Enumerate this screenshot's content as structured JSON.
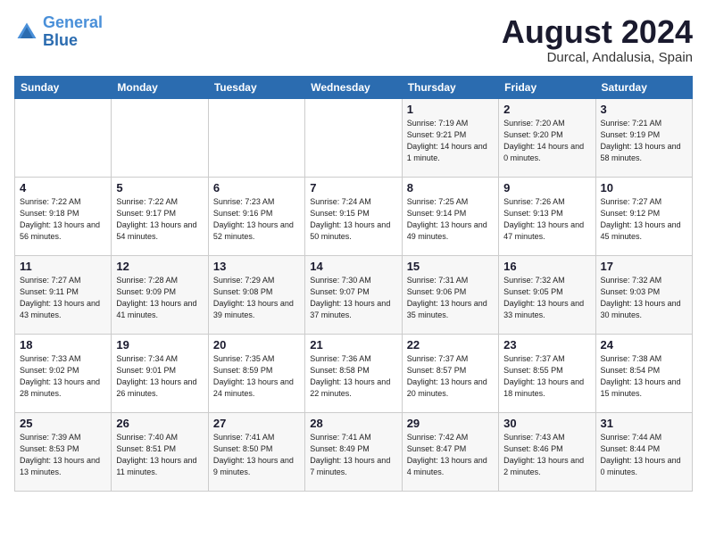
{
  "header": {
    "logo_line1": "General",
    "logo_line2": "Blue",
    "month_year": "August 2024",
    "location": "Durcal, Andalusia, Spain"
  },
  "weekdays": [
    "Sunday",
    "Monday",
    "Tuesday",
    "Wednesday",
    "Thursday",
    "Friday",
    "Saturday"
  ],
  "weeks": [
    [
      {
        "day": "",
        "info": ""
      },
      {
        "day": "",
        "info": ""
      },
      {
        "day": "",
        "info": ""
      },
      {
        "day": "",
        "info": ""
      },
      {
        "day": "1",
        "info": "Sunrise: 7:19 AM\nSunset: 9:21 PM\nDaylight: 14 hours\nand 1 minute."
      },
      {
        "day": "2",
        "info": "Sunrise: 7:20 AM\nSunset: 9:20 PM\nDaylight: 14 hours\nand 0 minutes."
      },
      {
        "day": "3",
        "info": "Sunrise: 7:21 AM\nSunset: 9:19 PM\nDaylight: 13 hours\nand 58 minutes."
      }
    ],
    [
      {
        "day": "4",
        "info": "Sunrise: 7:22 AM\nSunset: 9:18 PM\nDaylight: 13 hours\nand 56 minutes."
      },
      {
        "day": "5",
        "info": "Sunrise: 7:22 AM\nSunset: 9:17 PM\nDaylight: 13 hours\nand 54 minutes."
      },
      {
        "day": "6",
        "info": "Sunrise: 7:23 AM\nSunset: 9:16 PM\nDaylight: 13 hours\nand 52 minutes."
      },
      {
        "day": "7",
        "info": "Sunrise: 7:24 AM\nSunset: 9:15 PM\nDaylight: 13 hours\nand 50 minutes."
      },
      {
        "day": "8",
        "info": "Sunrise: 7:25 AM\nSunset: 9:14 PM\nDaylight: 13 hours\nand 49 minutes."
      },
      {
        "day": "9",
        "info": "Sunrise: 7:26 AM\nSunset: 9:13 PM\nDaylight: 13 hours\nand 47 minutes."
      },
      {
        "day": "10",
        "info": "Sunrise: 7:27 AM\nSunset: 9:12 PM\nDaylight: 13 hours\nand 45 minutes."
      }
    ],
    [
      {
        "day": "11",
        "info": "Sunrise: 7:27 AM\nSunset: 9:11 PM\nDaylight: 13 hours\nand 43 minutes."
      },
      {
        "day": "12",
        "info": "Sunrise: 7:28 AM\nSunset: 9:09 PM\nDaylight: 13 hours\nand 41 minutes."
      },
      {
        "day": "13",
        "info": "Sunrise: 7:29 AM\nSunset: 9:08 PM\nDaylight: 13 hours\nand 39 minutes."
      },
      {
        "day": "14",
        "info": "Sunrise: 7:30 AM\nSunset: 9:07 PM\nDaylight: 13 hours\nand 37 minutes."
      },
      {
        "day": "15",
        "info": "Sunrise: 7:31 AM\nSunset: 9:06 PM\nDaylight: 13 hours\nand 35 minutes."
      },
      {
        "day": "16",
        "info": "Sunrise: 7:32 AM\nSunset: 9:05 PM\nDaylight: 13 hours\nand 33 minutes."
      },
      {
        "day": "17",
        "info": "Sunrise: 7:32 AM\nSunset: 9:03 PM\nDaylight: 13 hours\nand 30 minutes."
      }
    ],
    [
      {
        "day": "18",
        "info": "Sunrise: 7:33 AM\nSunset: 9:02 PM\nDaylight: 13 hours\nand 28 minutes."
      },
      {
        "day": "19",
        "info": "Sunrise: 7:34 AM\nSunset: 9:01 PM\nDaylight: 13 hours\nand 26 minutes."
      },
      {
        "day": "20",
        "info": "Sunrise: 7:35 AM\nSunset: 8:59 PM\nDaylight: 13 hours\nand 24 minutes."
      },
      {
        "day": "21",
        "info": "Sunrise: 7:36 AM\nSunset: 8:58 PM\nDaylight: 13 hours\nand 22 minutes."
      },
      {
        "day": "22",
        "info": "Sunrise: 7:37 AM\nSunset: 8:57 PM\nDaylight: 13 hours\nand 20 minutes."
      },
      {
        "day": "23",
        "info": "Sunrise: 7:37 AM\nSunset: 8:55 PM\nDaylight: 13 hours\nand 18 minutes."
      },
      {
        "day": "24",
        "info": "Sunrise: 7:38 AM\nSunset: 8:54 PM\nDaylight: 13 hours\nand 15 minutes."
      }
    ],
    [
      {
        "day": "25",
        "info": "Sunrise: 7:39 AM\nSunset: 8:53 PM\nDaylight: 13 hours\nand 13 minutes."
      },
      {
        "day": "26",
        "info": "Sunrise: 7:40 AM\nSunset: 8:51 PM\nDaylight: 13 hours\nand 11 minutes."
      },
      {
        "day": "27",
        "info": "Sunrise: 7:41 AM\nSunset: 8:50 PM\nDaylight: 13 hours\nand 9 minutes."
      },
      {
        "day": "28",
        "info": "Sunrise: 7:41 AM\nSunset: 8:49 PM\nDaylight: 13 hours\nand 7 minutes."
      },
      {
        "day": "29",
        "info": "Sunrise: 7:42 AM\nSunset: 8:47 PM\nDaylight: 13 hours\nand 4 minutes."
      },
      {
        "day": "30",
        "info": "Sunrise: 7:43 AM\nSunset: 8:46 PM\nDaylight: 13 hours\nand 2 minutes."
      },
      {
        "day": "31",
        "info": "Sunrise: 7:44 AM\nSunset: 8:44 PM\nDaylight: 13 hours\nand 0 minutes."
      }
    ]
  ]
}
